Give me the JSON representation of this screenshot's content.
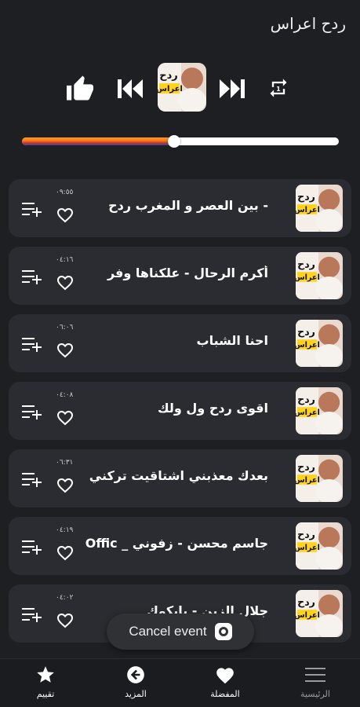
{
  "header": {
    "title": "ردح اعراس"
  },
  "player": {
    "progress": 0.48,
    "cover_label": "ردح اعراس"
  },
  "tracks": [
    {
      "title": "- بين العصر و المغرب ردح",
      "duration": "٠٩:٥٥"
    },
    {
      "title": "أكرم الرحال - علكناها وفر",
      "duration": "٠٤:١٦"
    },
    {
      "title": "احنا الشباب",
      "duration": "٠٦:٠٦"
    },
    {
      "title": "اقوى ردح ول ولك",
      "duration": "٠٤:٠٨"
    },
    {
      "title": "بعدك معذبني اشتاقيت تركني",
      "duration": "٠٦:٣١"
    },
    {
      "title": "جاسم محسن - زفوني _ Offic",
      "duration": "٠٤:١٩"
    },
    {
      "title": "جلال الزين - بابكوك",
      "duration": "٠٤:٠٢"
    }
  ],
  "toast": {
    "text": "Cancel event"
  },
  "nav": {
    "rate": "تقييم",
    "more": "المزيد",
    "favorites": "المفضلة",
    "home": "الرئيسية"
  },
  "icons": {
    "like": "thumbs-up-icon",
    "prev": "skip-previous-icon",
    "next": "skip-next-icon",
    "repeat": "repeat-icon",
    "heart": "heart-outline-icon",
    "queue": "playlist-add-icon",
    "star": "star-icon",
    "back": "arrow-left-circle-icon",
    "heart_filled": "heart-filled-icon",
    "menu": "menu-icon"
  },
  "colors": {
    "background": "#1e1f22",
    "row": "#2a2c31",
    "progress_start": "#ff9b1a",
    "progress_end": "#3a3fa8"
  }
}
